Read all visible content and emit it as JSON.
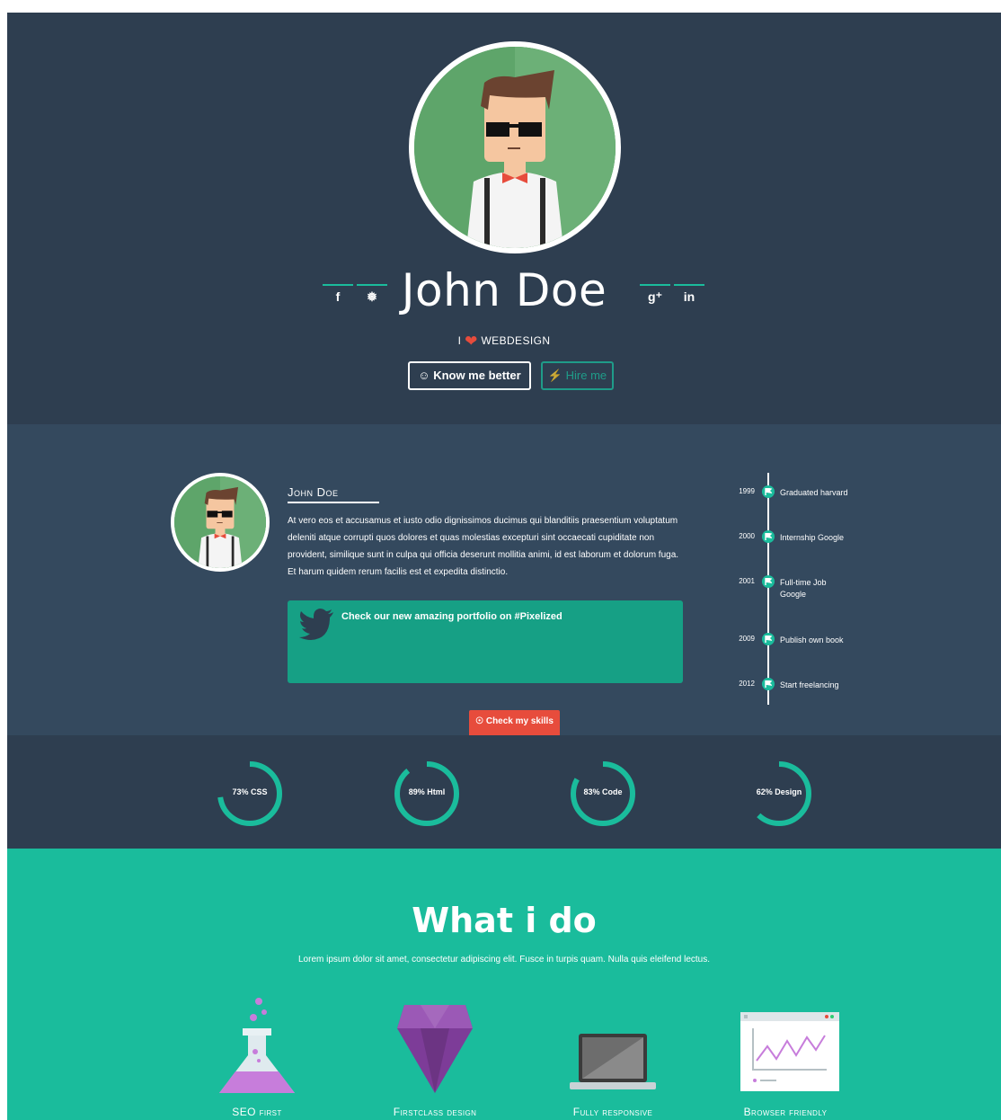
{
  "hero": {
    "name": "John Doe",
    "social": [
      {
        "name": "facebook-icon",
        "glyph": "f"
      },
      {
        "name": "twitter-icon",
        "glyph": "❅"
      },
      {
        "name": "google-plus-icon",
        "glyph": "g⁺"
      },
      {
        "name": "linkedin-icon",
        "glyph": "in"
      }
    ],
    "tagline_i": "I",
    "tagline_word": "WEBDESIGN",
    "know_button": "Know me better",
    "hire_button": "Hire me"
  },
  "about": {
    "title": "John Doe",
    "text": "At vero eos et accusamus et iusto odio dignissimos ducimus qui blanditiis praesentium voluptatum deleniti atque corrupti quos dolores et quas molestias excepturi sint occaecati cupiditate non provident, similique sunt in culpa qui officia deserunt mollitia animi, id est laborum et dolorum fuga. Et harum quidem rerum facilis est et expedita distinctio.",
    "tweet": "Check our new amazing portfolio on #Pixelized",
    "skills_button": "Check my skills"
  },
  "timeline": [
    {
      "year": "1999",
      "label": "Graduated harvard"
    },
    {
      "year": "2000",
      "label": "Internship Google"
    },
    {
      "year": "2001",
      "label": "Full-time Job Google"
    },
    {
      "year": "2009",
      "label": "Publish own book"
    },
    {
      "year": "2012",
      "label": "Start freelancing"
    }
  ],
  "skills": [
    {
      "label": "73% CSS",
      "percent": 73
    },
    {
      "label": "89% Html",
      "percent": 89
    },
    {
      "label": "83% Code",
      "percent": 83
    },
    {
      "label": "62% Design",
      "percent": 62
    }
  ],
  "whatido": {
    "title": "What i do",
    "subtitle": "Lorem ipsum dolor sit amet, consectetur adipiscing elit. Fusce in turpis quam. Nulla quis eleifend lectus.",
    "services": [
      {
        "label": "SEO first",
        "icon": "flask-icon"
      },
      {
        "label": "Firstclass design",
        "icon": "diamond-icon"
      },
      {
        "label": "Fully responsive",
        "icon": "laptop-icon"
      },
      {
        "label": "Browser friendly",
        "icon": "browser-chart-icon"
      }
    ]
  },
  "colors": {
    "dark": "#2e3e50",
    "mid": "#34495e",
    "accent": "#1abc9c",
    "accent_dark": "#16a085",
    "red": "#e74c3c"
  }
}
